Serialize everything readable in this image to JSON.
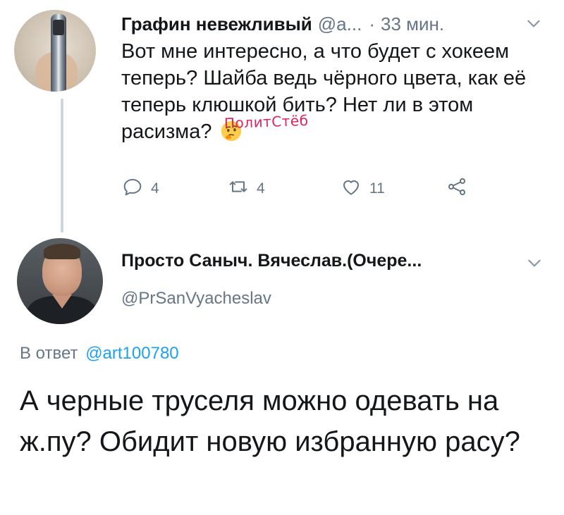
{
  "tweet1": {
    "author_name": "Графин невежливый",
    "handle": "@а...",
    "separator": "·",
    "time": "33 мин.",
    "text": "Вот мне интересно, а что будет с хокеем теперь? Шайба ведь чёрного цвета, как её теперь клюшкой бить? Нет ли в этом расизма?",
    "emoji": "thinking-face",
    "actions": {
      "replies": "4",
      "retweets": "4",
      "likes": "11"
    }
  },
  "watermark": "ПолитСтёб",
  "tweet2": {
    "author_name": "Просто Саныч. Вячеслав.(Очере...",
    "handle": "@PrSanVyacheslav",
    "reply_to_label": "В ответ",
    "reply_to_handle": "@art100780",
    "text": "А черные труселя можно одевать на ж.пу? Обидит новую избранную расу?"
  },
  "colors": {
    "text": "#14171a",
    "secondary": "#657786",
    "link": "#1da1f2",
    "thread_line": "#ccd6dd",
    "watermark": "#e0245e"
  }
}
